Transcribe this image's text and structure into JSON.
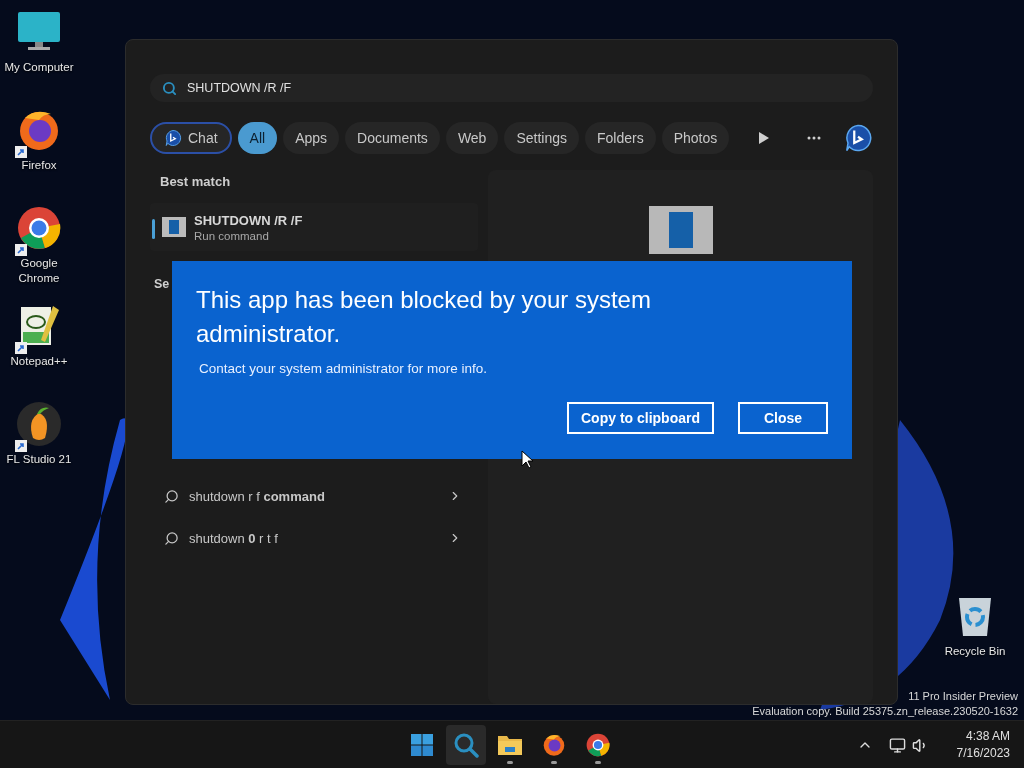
{
  "desktop_icons": [
    {
      "label": "My Computer",
      "kind": "computer",
      "shortcut": false
    },
    {
      "label": "Firefox",
      "kind": "firefox",
      "shortcut": true
    },
    {
      "label": "Google Chrome",
      "kind": "chrome",
      "shortcut": true
    },
    {
      "label": "Notepad++",
      "kind": "notepad",
      "shortcut": true
    },
    {
      "label": "FL Studio 21",
      "kind": "flstudio",
      "shortcut": true
    }
  ],
  "recycle_bin": {
    "label": "Recycle Bin"
  },
  "watermark": [
    "11 Pro Insider Preview",
    "Evaluation copy. Build 25375.zn_release.230520-1632"
  ],
  "search": {
    "query": "SHUTDOWN /R /F",
    "filters": [
      {
        "label": "Chat",
        "kind": "chat",
        "selected": false
      },
      {
        "label": "All",
        "kind": "plain",
        "selected": true
      },
      {
        "label": "Apps",
        "kind": "plain",
        "selected": false
      },
      {
        "label": "Documents",
        "kind": "plain",
        "selected": false
      },
      {
        "label": "Web",
        "kind": "plain",
        "selected": false
      },
      {
        "label": "Settings",
        "kind": "plain",
        "selected": false
      },
      {
        "label": "Folders",
        "kind": "plain",
        "selected": false
      },
      {
        "label": "Photos",
        "kind": "plain",
        "selected": false
      }
    ],
    "best_match_heading": "Best match",
    "best_match": {
      "title": "SHUTDOWN /R /F",
      "subtitle": "Run command"
    },
    "suggestions_heading": "Se",
    "suggestions": [
      "shutdown r f **command**",
      "shutdown **0** r t f"
    ]
  },
  "dialog": {
    "title": "This app has been blocked by your system administrator.",
    "message": "Contact your system administrator for more info.",
    "buttons": [
      "Copy to clipboard",
      "Close"
    ]
  },
  "taskbar": {
    "apps": [
      {
        "kind": "start",
        "active": false,
        "running": false
      },
      {
        "kind": "search",
        "active": true,
        "running": false
      },
      {
        "kind": "folder",
        "active": false,
        "running": true
      },
      {
        "kind": "firefox",
        "active": false,
        "running": true
      },
      {
        "kind": "chrome",
        "active": false,
        "running": true
      }
    ],
    "time": "4:38 AM",
    "date": "7/16/2023"
  }
}
